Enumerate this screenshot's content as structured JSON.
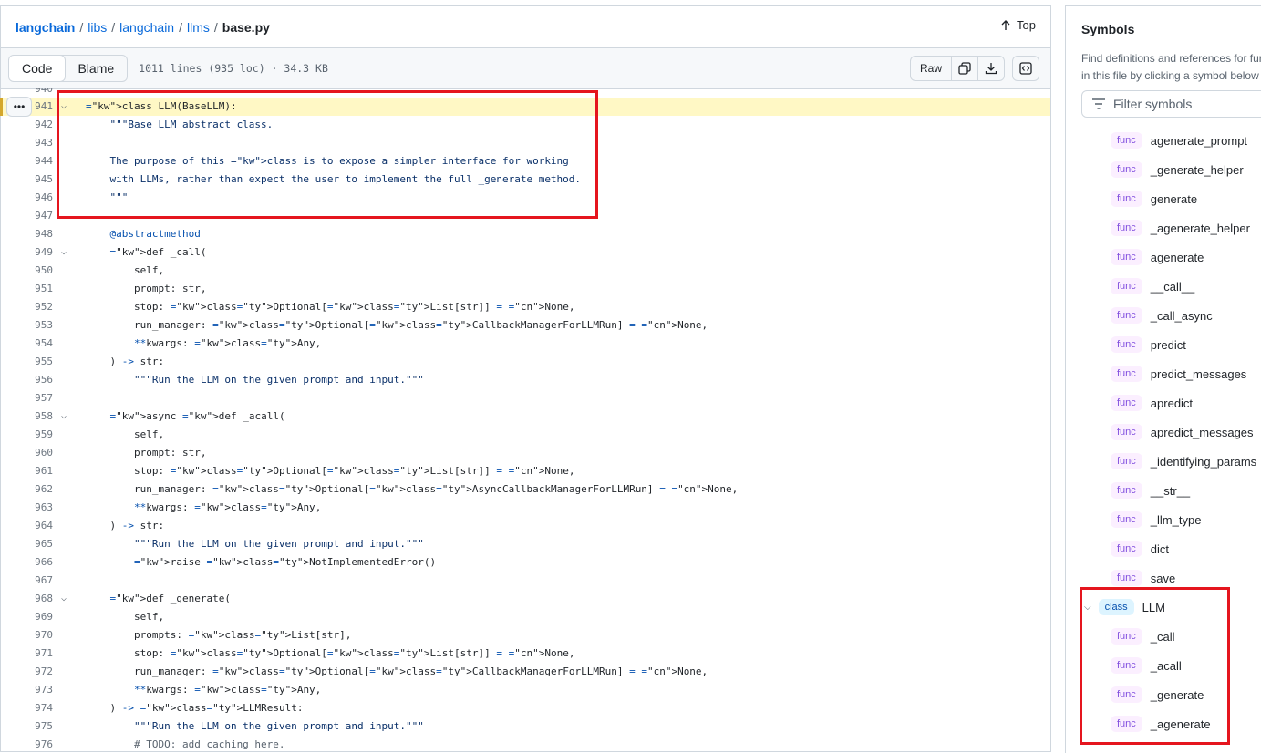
{
  "breadcrumb": {
    "items": [
      "langchain",
      "libs",
      "langchain",
      "llms"
    ],
    "separator": "/",
    "file": "base.py",
    "top_label": "Top"
  },
  "toolbar": {
    "code_tab": "Code",
    "blame_tab": "Blame",
    "file_meta": "1011 lines (935 loc) · 34.3 KB",
    "raw_label": "Raw"
  },
  "code": {
    "first_partial_line": "940",
    "lines": [
      {
        "n": "941",
        "t": "class LLM(BaseLLM):"
      },
      {
        "n": "942",
        "t": "    \"\"\"Base LLM abstract class."
      },
      {
        "n": "943",
        "t": ""
      },
      {
        "n": "944",
        "t": "    The purpose of this class is to expose a simpler interface for working"
      },
      {
        "n": "945",
        "t": "    with LLMs, rather than expect the user to implement the full _generate method."
      },
      {
        "n": "946",
        "t": "    \"\"\""
      },
      {
        "n": "947",
        "t": ""
      },
      {
        "n": "948",
        "t": "    @abstractmethod"
      },
      {
        "n": "949",
        "t": "    def _call("
      },
      {
        "n": "950",
        "t": "        self,"
      },
      {
        "n": "951",
        "t": "        prompt: str,"
      },
      {
        "n": "952",
        "t": "        stop: Optional[List[str]] = None,"
      },
      {
        "n": "953",
        "t": "        run_manager: Optional[CallbackManagerForLLMRun] = None,"
      },
      {
        "n": "954",
        "t": "        **kwargs: Any,"
      },
      {
        "n": "955",
        "t": "    ) -> str:"
      },
      {
        "n": "956",
        "t": "        \"\"\"Run the LLM on the given prompt and input.\"\"\""
      },
      {
        "n": "957",
        "t": ""
      },
      {
        "n": "958",
        "t": "    async def _acall("
      },
      {
        "n": "959",
        "t": "        self,"
      },
      {
        "n": "960",
        "t": "        prompt: str,"
      },
      {
        "n": "961",
        "t": "        stop: Optional[List[str]] = None,"
      },
      {
        "n": "962",
        "t": "        run_manager: Optional[AsyncCallbackManagerForLLMRun] = None,"
      },
      {
        "n": "963",
        "t": "        **kwargs: Any,"
      },
      {
        "n": "964",
        "t": "    ) -> str:"
      },
      {
        "n": "965",
        "t": "        \"\"\"Run the LLM on the given prompt and input.\"\"\""
      },
      {
        "n": "966",
        "t": "        raise NotImplementedError()"
      },
      {
        "n": "967",
        "t": ""
      },
      {
        "n": "968",
        "t": "    def _generate("
      },
      {
        "n": "969",
        "t": "        self,"
      },
      {
        "n": "970",
        "t": "        prompts: List[str],"
      },
      {
        "n": "971",
        "t": "        stop: Optional[List[str]] = None,"
      },
      {
        "n": "972",
        "t": "        run_manager: Optional[CallbackManagerForLLMRun] = None,"
      },
      {
        "n": "973",
        "t": "        **kwargs: Any,"
      },
      {
        "n": "974",
        "t": "    ) -> LLMResult:"
      },
      {
        "n": "975",
        "t": "        \"\"\"Run the LLM on the given prompt and input.\"\"\""
      },
      {
        "n": "976",
        "t": "        # TODO: add caching here."
      }
    ],
    "fold_lines": [
      "941",
      "949",
      "958",
      "968"
    ],
    "highlighted_line": "941"
  },
  "symbols": {
    "title": "Symbols",
    "description": "Find definitions and references for fur\nin this file by clicking a symbol below",
    "filter_placeholder": "Filter symbols",
    "items": [
      {
        "kind": "func",
        "name": "agenerate_prompt"
      },
      {
        "kind": "func",
        "name": "_generate_helper"
      },
      {
        "kind": "func",
        "name": "generate"
      },
      {
        "kind": "func",
        "name": "_agenerate_helper"
      },
      {
        "kind": "func",
        "name": "agenerate"
      },
      {
        "kind": "func",
        "name": "__call__"
      },
      {
        "kind": "func",
        "name": "_call_async"
      },
      {
        "kind": "func",
        "name": "predict"
      },
      {
        "kind": "func",
        "name": "predict_messages"
      },
      {
        "kind": "func",
        "name": "apredict"
      },
      {
        "kind": "func",
        "name": "apredict_messages"
      },
      {
        "kind": "func",
        "name": "_identifying_params"
      },
      {
        "kind": "func",
        "name": "__str__"
      },
      {
        "kind": "func",
        "name": "_llm_type"
      },
      {
        "kind": "func",
        "name": "dict"
      },
      {
        "kind": "func",
        "name": "save"
      },
      {
        "kind": "class",
        "name": "LLM"
      },
      {
        "kind": "func",
        "name": "_call"
      },
      {
        "kind": "func",
        "name": "_acall"
      },
      {
        "kind": "func",
        "name": "_generate"
      },
      {
        "kind": "func",
        "name": "_agenerate"
      }
    ]
  },
  "colors": {
    "annotation_red": "#e5151e",
    "line_highlight": "#fff8c5",
    "link_blue": "#0969da"
  }
}
